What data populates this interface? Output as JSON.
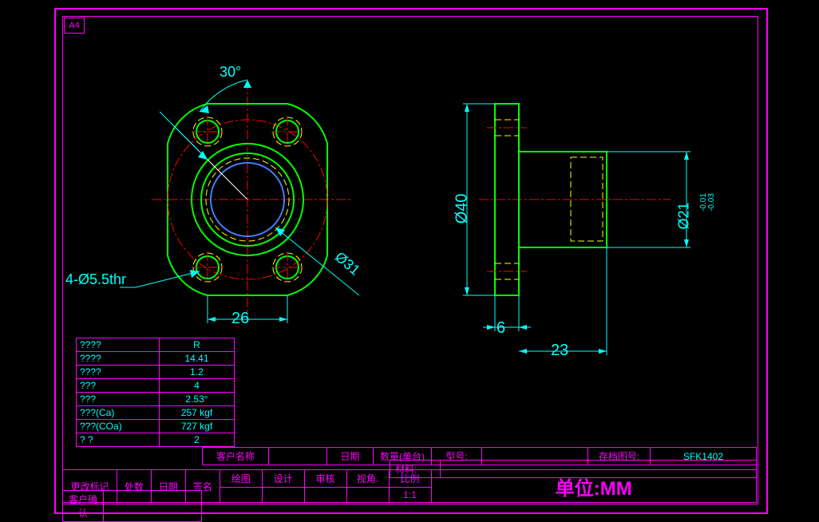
{
  "sheet_label": "A4",
  "dimensions": {
    "angle": "30°",
    "dia_31": "Ø31",
    "holes": "4-Ø5.5thr",
    "width_26": "26",
    "dia_40": "Ø40",
    "flange_6": "6",
    "length_23": "23",
    "dia_21": "Ø21",
    "tol_upper": "-0.01",
    "tol_lower": "-0.03"
  },
  "spec_table": {
    "rows": [
      {
        "k": "????",
        "v": "R"
      },
      {
        "k": "????",
        "v": "14.41"
      },
      {
        "k": "????",
        "v": "1.2"
      },
      {
        "k": "???",
        "v": "4"
      },
      {
        "k": "???",
        "v": "2.53°"
      },
      {
        "k": "???(Ca)",
        "v": "257 kgf"
      },
      {
        "k": "???(COa)",
        "v": "727 kgf"
      },
      {
        "k": "?  ?",
        "v": "2"
      }
    ]
  },
  "title_block": {
    "customer_name": "客户名称",
    "date": "日期",
    "qty": "数量(单台)",
    "model": "型号:",
    "archive": "存档图号:",
    "archive_val": "SFK1402",
    "material": "材料:",
    "drawn": "绘图",
    "design": "设计",
    "check": "审核",
    "view": "视角.",
    "scale": "比例",
    "scale_val": "1:1",
    "unit": "单位:MM",
    "rev_mark": "更改标记",
    "pos": "处数",
    "date2": "日期",
    "sign": "签名",
    "confirm": "客户确认"
  }
}
